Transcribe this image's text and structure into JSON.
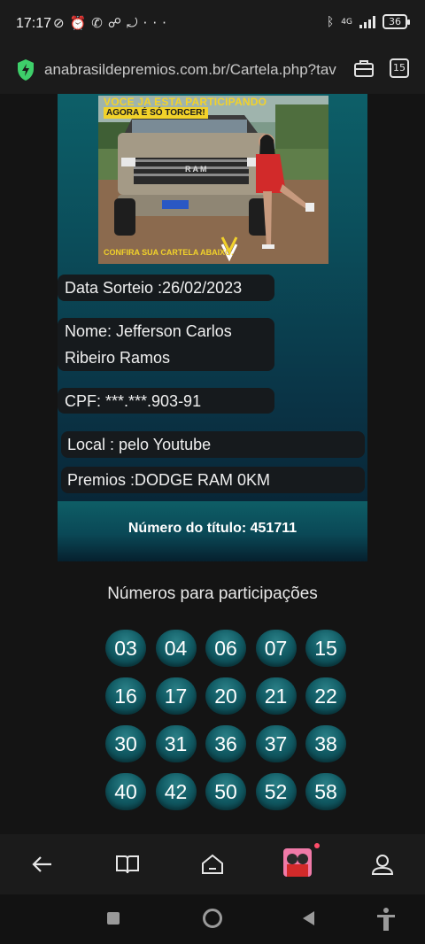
{
  "status_bar": {
    "time": "17:17",
    "notification_icons": [
      "mute-icon",
      "alarm-icon",
      "whatsapp-icon",
      "missed-call-icon",
      "sync-off-icon"
    ],
    "overflow": "···",
    "network": "4G",
    "battery": "36"
  },
  "browser": {
    "url": "anabrasildepremios.com.br/Cartela.php?tav",
    "tab_count": "15",
    "secure_color": "#4cd964"
  },
  "banner": {
    "headline": "VOCE JA ESTA PARTICIPANDO",
    "subheadline": "AGORA É SÓ TORCER!",
    "footer": "CONFIRA SUA CARTELA ABAIXO.",
    "grille_text": "RAM"
  },
  "card": {
    "data_sorteio": "Data Sorteio :26/02/2023",
    "nome_line1": "Nome: Jefferson Carlos",
    "nome_line2": "Ribeiro Ramos",
    "cpf": "CPF: ***.***.903-91",
    "local": "Local : pelo Youtube",
    "premios": "Premios :DODGE RAM 0KM",
    "numero_titulo": "Número do título: 451711"
  },
  "numbers_section": {
    "title": "Números para participações",
    "numbers": [
      "03",
      "04",
      "06",
      "07",
      "15",
      "16",
      "17",
      "20",
      "21",
      "22",
      "30",
      "31",
      "36",
      "37",
      "38",
      "40",
      "42",
      "50",
      "52",
      "58"
    ]
  },
  "bottom_nav": {
    "items": [
      "back-arrow-icon",
      "reading-mode-icon",
      "home-icon",
      "app-avatar-icon",
      "profile-icon"
    ]
  },
  "colors": {
    "card_top": "#0d5f68",
    "ball": "#125d66",
    "banner_yellow": "#f2d22a"
  }
}
